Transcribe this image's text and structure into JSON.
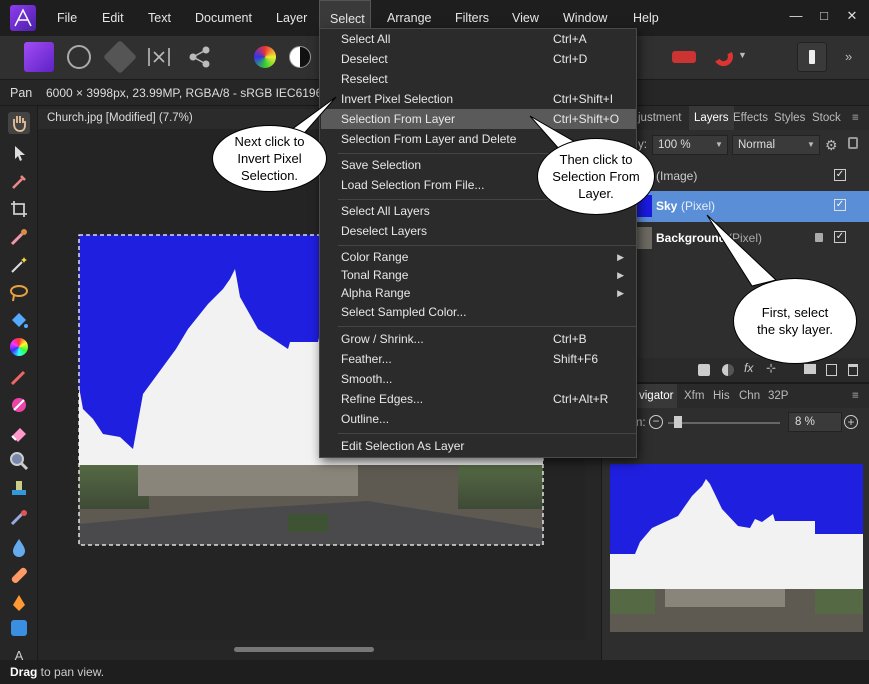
{
  "menubar": {
    "items": [
      "File",
      "Edit",
      "Text",
      "Document",
      "Layer",
      "Select",
      "Arrange",
      "Filters",
      "View",
      "Window",
      "Help"
    ],
    "active": "Select"
  },
  "context": {
    "tool": "Pan",
    "info": "6000 × 3998px, 23.99MP, RGBA/8 - sRGB IEC61966-"
  },
  "document": {
    "tab": "Church.jpg [Modified] (7.7%)"
  },
  "select_menu": {
    "items": [
      {
        "label": "Select All",
        "shortcut": "Ctrl+A"
      },
      {
        "label": "Deselect",
        "shortcut": "Ctrl+D"
      },
      {
        "label": "Reselect",
        "shortcut": ""
      },
      {
        "label": "Invert Pixel Selection",
        "shortcut": "Ctrl+Shift+I"
      },
      {
        "label": "Selection From Layer",
        "shortcut": "Ctrl+Shift+O"
      },
      {
        "label": "Selection From Layer and Delete",
        "shortcut": ""
      },
      {
        "label": "Save Selection",
        "shortcut": ""
      },
      {
        "label": "Load Selection From File...",
        "shortcut": ""
      },
      {
        "label": "Select All Layers",
        "shortcut": ""
      },
      {
        "label": "Deselect Layers",
        "shortcut": ""
      },
      {
        "label": "Color Range",
        "shortcut": ""
      },
      {
        "label": "Tonal Range",
        "shortcut": ""
      },
      {
        "label": "Alpha Range",
        "shortcut": ""
      },
      {
        "label": "Select Sampled Color...",
        "shortcut": ""
      },
      {
        "label": "Grow / Shrink...",
        "shortcut": "Ctrl+B"
      },
      {
        "label": "Feather...",
        "shortcut": "Shift+F6"
      },
      {
        "label": "Smooth...",
        "shortcut": ""
      },
      {
        "label": "Refine Edges...",
        "shortcut": "Ctrl+Alt+R"
      },
      {
        "label": "Outline...",
        "shortcut": ""
      },
      {
        "label": "Edit Selection As Layer",
        "shortcut": ""
      }
    ]
  },
  "layers_panel": {
    "tabs": [
      "justment",
      "Layers",
      "Effects",
      "Styles",
      "Stock"
    ],
    "opacity_label": "y:",
    "opacity": "100 %",
    "blend_mode": "Normal",
    "layers": [
      {
        "name": "(Image)",
        "type": ""
      },
      {
        "name": "Sky",
        "type": "(Pixel)"
      },
      {
        "name": "Background",
        "type": "(Pixel)"
      }
    ]
  },
  "navigator_panel": {
    "tabs": [
      "vigator",
      "Xfm",
      "His",
      "Chn",
      "32P"
    ],
    "zoom_label": "n:",
    "zoom": "8 %"
  },
  "callouts": {
    "invert": "Next click to Invert Pixel Selection.",
    "from_layer": "Then click to Selection From Layer.",
    "first": "First, select the sky layer."
  },
  "status": {
    "bold": "Drag",
    "text": " to pan view."
  },
  "colors": {
    "accent": "#5a8fd8",
    "sky": "#1919e6",
    "menu_bg": "#2b2b2b"
  }
}
